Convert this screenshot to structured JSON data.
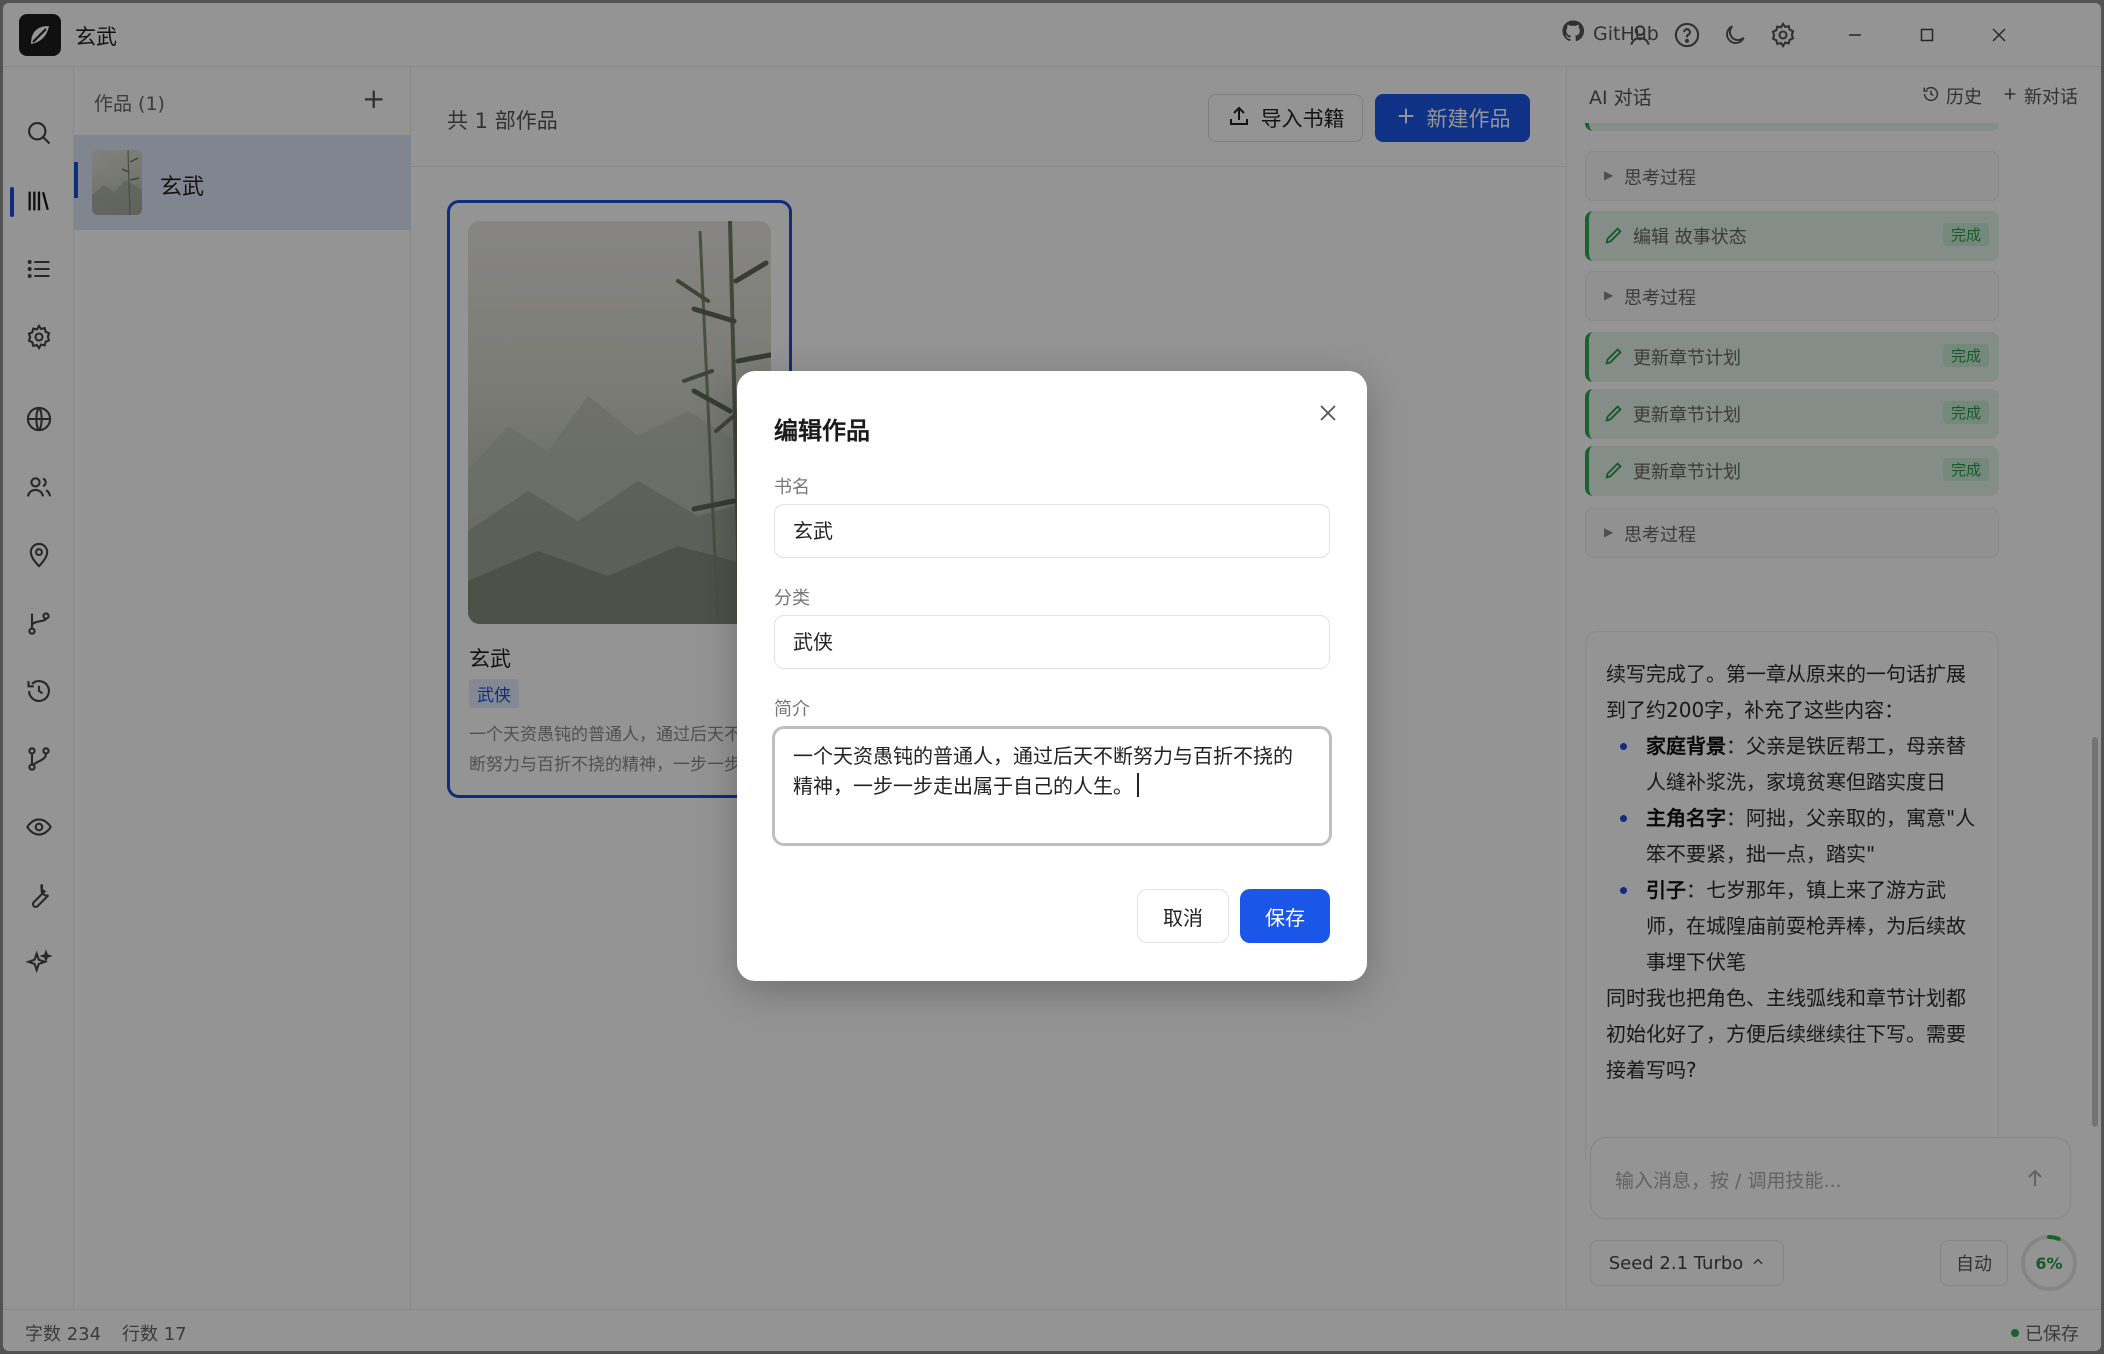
{
  "app": {
    "title": "玄武"
  },
  "titlebar": {
    "github_label": "GitHub",
    "icons": [
      "github-icon",
      "user-icon",
      "help-icon",
      "moon-icon",
      "gear-icon"
    ],
    "window_controls": [
      "minimize-icon",
      "maximize-icon",
      "close-icon"
    ]
  },
  "rail": {
    "items": [
      "search-icon",
      "library-icon",
      "list-icon",
      "settings-icon",
      "globe-icon",
      "people-icon",
      "location-icon",
      "branch-icon",
      "history-icon",
      "flow-icon",
      "eye-icon",
      "wrench-icon",
      "sparkle-icon"
    ],
    "active": "library-icon"
  },
  "works": {
    "header": "作品 (1)",
    "add_label": "+",
    "items": [
      {
        "label": "玄武"
      }
    ]
  },
  "main": {
    "count_label": "共 1 部作品",
    "import_label": "导入书籍",
    "new_label": "新建作品",
    "book": {
      "title": "玄武",
      "tag": "武侠",
      "desc_line1": "一个天资愚钝的普通人，通过后天不",
      "desc_line2": "断努力与百折不挠的精神，一步一步"
    }
  },
  "chat": {
    "title": "AI 对话",
    "history_label": "历史",
    "new_chat_label": "新对话",
    "steps": [
      {
        "type": "think",
        "label": "思考过程"
      },
      {
        "type": "tool",
        "label": "编辑 故事状态",
        "badge": "完成"
      },
      {
        "type": "think",
        "label": "思考过程"
      },
      {
        "type": "tool",
        "label": "更新章节计划",
        "badge": "完成"
      },
      {
        "type": "tool",
        "label": "更新章节计划",
        "badge": "完成"
      },
      {
        "type": "tool",
        "label": "更新章节计划",
        "badge": "完成"
      },
      {
        "type": "think",
        "label": "思考过程"
      }
    ],
    "message": {
      "intro": "续写完成了。第一章从原来的一句话扩展到了约200字，补充了这些内容：",
      "bullets": [
        {
          "bold": "家庭背景",
          "text": "：父亲是铁匠帮工，母亲替人缝补浆洗，家境贫寒但踏实度日"
        },
        {
          "bold": "主角名字",
          "text": "：阿拙，父亲取的，寓意\"人笨不要紧，拙一点，踏实\""
        },
        {
          "bold": "引子",
          "text": "：七岁那年，镇上来了游方武师，在城隍庙前耍枪弄棒，为后续故事埋下伏笔"
        }
      ],
      "outro": "同时我也把角色、主线弧线和章节计划都初始化好了，方便后续继续往下写。需要接着写吗?"
    },
    "input_placeholder": "输入消息，按 / 调用技能...",
    "model": "Seed 2.1 Turbo",
    "auto_label": "自动",
    "context_usage": "6%",
    "context_usage_value": 0.06
  },
  "statusbar": {
    "words": "字数 234",
    "lines": "行数 17",
    "saved": "已保存"
  },
  "modal": {
    "title": "编辑作品",
    "name_label": "书名",
    "name_value": "玄武",
    "category_label": "分类",
    "category_value": "武侠",
    "intro_label": "简介",
    "intro_value": "一个天资愚钝的普通人，通过后天不断努力与百折不挠的精神，一步一步走出属于自己的人生。",
    "cancel_label": "取消",
    "save_label": "保存"
  },
  "colors": {
    "accent": "#1a56e8",
    "success": "#2ea84f",
    "overlay": "rgba(0,0,0,0.42)"
  }
}
